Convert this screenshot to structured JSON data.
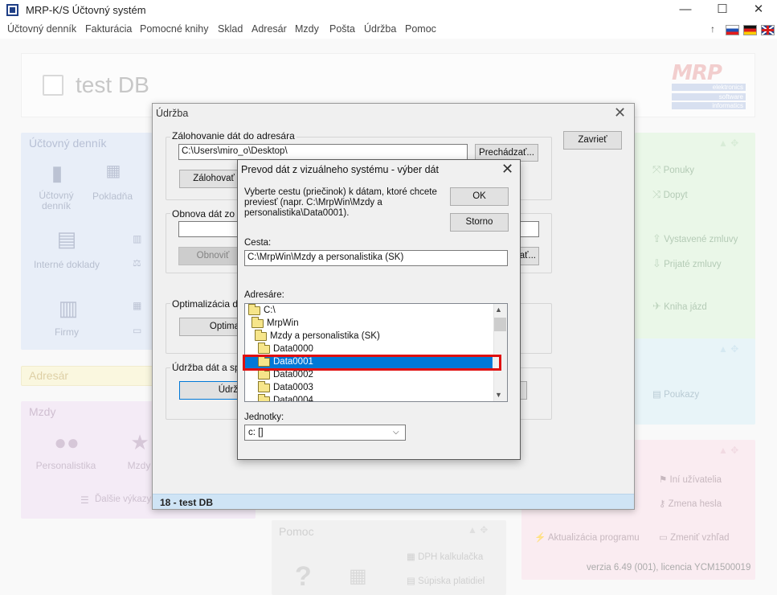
{
  "window": {
    "title": "MRP-K/S Účtovný systém"
  },
  "menu": [
    "Účtovný denník",
    "Fakturácia",
    "Pomocné knihy",
    "Sklad",
    "Adresár",
    "Mzdy",
    "Pošta",
    "Údržba",
    "Pomoc"
  ],
  "header": {
    "db_title": "test DB",
    "logo_text": "MRP",
    "logo_lines": [
      "elektronics",
      "software",
      "informatics"
    ]
  },
  "cards": {
    "ucto": {
      "title": "Účtovný denník",
      "items": [
        "Účtovný denník",
        "Pokladňa",
        "Interné doklady",
        "Firmy"
      ]
    },
    "adresar": {
      "title": "Adresár"
    },
    "mzdy": {
      "title": "Mzdy",
      "items": [
        "Personalistika",
        "Mzdy"
      ],
      "extra": "Ďalšie výkazy"
    },
    "pomoc": {
      "title": "Pomoc",
      "items": [
        "DPH kalkulačka",
        "Súpiska platidiel"
      ]
    },
    "right1": {
      "items": [
        "Ponuky",
        "Dopyt",
        "Vystavené zmluvy",
        "Prijaté zmluvy",
        "Kniha jázd"
      ]
    },
    "right2": {
      "items": [
        "Poukazy"
      ]
    },
    "right3": {
      "items": [
        "Iní užívatelia",
        "Zmena hesla",
        "Aktualizácia programu",
        "Zmeniť vzhľad"
      ],
      "version": "verzia 6.49 (001), licencia YCM1500019"
    }
  },
  "udrzba": {
    "title": "Údržba",
    "close_label": "Zavrieť",
    "backup": {
      "label": "Zálohovanie dát do adresára",
      "path": "C:\\Users\\miro_o\\Desktop\\",
      "browse": "Prechádzať...",
      "run": "Zálohovať"
    },
    "restore": {
      "label": "Obnova dát zo zá",
      "run": "Obnoviť",
      "browse": "ať..."
    },
    "optimize": {
      "label": "Optimalizácia dát",
      "run": "Optima"
    },
    "maintain": {
      "label": "Údržba dát a spr",
      "run": "Údrž"
    },
    "status": "18 - test DB"
  },
  "picker": {
    "title": "Prevod dát z vizuálneho systému - výber dát",
    "description": "Vyberte cestu (priečinok) k dátam, ktoré chcete previesť (napr. C:\\MrpWin\\Mzdy a personalistika\\Data0001).",
    "ok": "OK",
    "cancel": "Storno",
    "path_label": "Cesta:",
    "path_value": "C:\\MrpWin\\Mzdy a personalistika (SK)",
    "dirs_label": "Adresáre:",
    "dirs": [
      "C:\\",
      "MrpWin",
      "Mzdy a personalistika (SK)",
      "Data0000",
      "Data0001",
      "Data0002",
      "Data0003",
      "Data0004"
    ],
    "selected_dir": "Data0001",
    "drives_label": "Jednotky:",
    "drive_value": "c: []"
  }
}
